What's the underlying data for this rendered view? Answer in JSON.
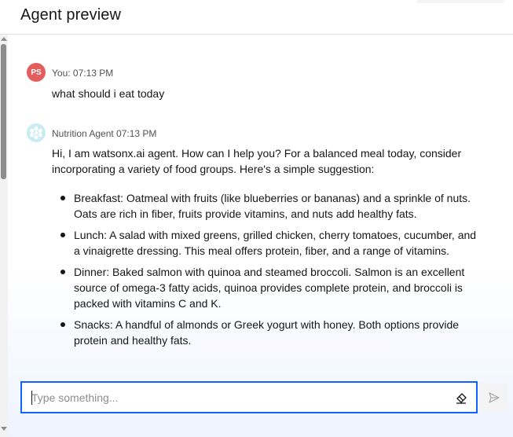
{
  "header": {
    "title": "Agent preview"
  },
  "messages": {
    "user": {
      "initials": "PS",
      "meta": "You: 07:13 PM",
      "text": "what should i eat today"
    },
    "agent": {
      "meta": "Nutrition Agent 07:13 PM",
      "intro": "Hi, I am watsonx.ai agent. How can I help you? For a balanced meal today, consider incorporating a variety of food groups. Here's a simple suggestion:",
      "bullets": [
        "Breakfast: Oatmeal with fruits (like blueberries or bananas) and a sprinkle of nuts. Oats are rich in fiber, fruits provide vitamins, and nuts add healthy fats.",
        "Lunch: A salad with mixed greens, grilled chicken, cherry tomatoes, cucumber, and a vinaigrette dressing. This meal offers protein, fiber, and a range of vitamins.",
        "Dinner: Baked salmon with quinoa and steamed broccoli. Salmon is an excellent source of omega-3 fatty acids, quinoa provides complete protein, and broccoli is packed with vitamins C and K.",
        "Snacks: A handful of almonds or Greek yogurt with honey. Both options provide protein and healthy fats."
      ]
    }
  },
  "composer": {
    "value": "",
    "placeholder": "Type something..."
  },
  "icons": {
    "user_avatar": "user-avatar",
    "agent_avatar": "agent-avatar-icon",
    "clear": "eraser-icon",
    "send": "send-icon"
  },
  "colors": {
    "accent": "#0f62fe",
    "user_avatar": "#e35d5d",
    "agent_avatar": "#c9ecf2"
  }
}
